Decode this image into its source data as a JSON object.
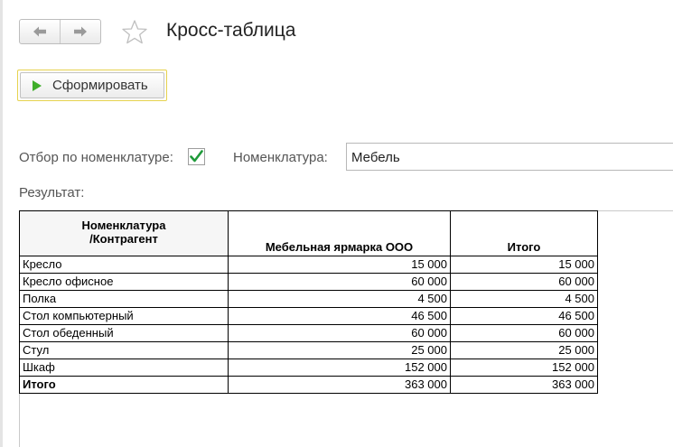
{
  "form": {
    "title": "Кросс-таблица",
    "generate_label": "Сформировать",
    "filter_label": "Отбор по номенклатуре:",
    "filter_checked": true,
    "nomenclature_label": "Номенклатура:",
    "nomenclature_value": "Мебель",
    "result_label": "Результат:"
  },
  "icons": {
    "back": "arrow-left-icon",
    "forward": "arrow-right-icon",
    "favorite": "star-icon",
    "generate": "play-icon",
    "check": "checkmark-icon"
  },
  "colors": {
    "play_icon": "#3fae2a",
    "checkmark": "#1f9a3a",
    "default_button_border": "#e6d24e"
  },
  "report": {
    "header_corner": [
      "Номенклатура",
      "/Контрагент"
    ],
    "columns": [
      "Мебельная ярмарка ООО",
      "Итого"
    ],
    "rows": [
      {
        "name": "Кресло",
        "values": [
          "15 000",
          "15 000"
        ]
      },
      {
        "name": "Кресло офисное",
        "values": [
          "60 000",
          "60 000"
        ]
      },
      {
        "name": "Полка",
        "values": [
          "4 500",
          "4 500"
        ]
      },
      {
        "name": "Стол компьютерный",
        "values": [
          "46 500",
          "46 500"
        ]
      },
      {
        "name": "Стол обеденный",
        "values": [
          "60 000",
          "60 000"
        ]
      },
      {
        "name": "Стул",
        "values": [
          "25 000",
          "25 000"
        ]
      },
      {
        "name": "Шкаф",
        "values": [
          "152 000",
          "152 000"
        ]
      }
    ],
    "total": {
      "name": "Итого",
      "values": [
        "363 000",
        "363 000"
      ]
    }
  }
}
